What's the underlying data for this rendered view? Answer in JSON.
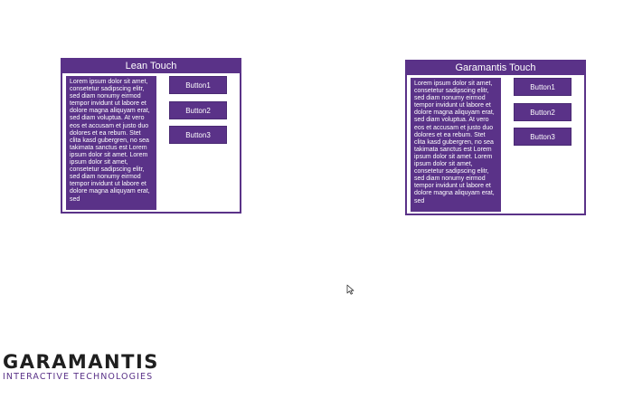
{
  "colors": {
    "accent": "#5a3288",
    "background": "#ffffff",
    "text_on_accent": "#ffffff",
    "logo_dark": "#1f1f1f"
  },
  "panels": [
    {
      "title": "Lean Touch",
      "body_text": "Lorem ipsum dolor sit amet, consetetur sadipscing elitr, sed diam nonumy eirmod tempor invidunt ut labore et dolore magna aliquyam erat, sed diam voluptua. At vero eos et accusam et justo duo dolores et ea rebum. Stet clita kasd gubergren, no sea takimata sanctus est Lorem ipsum dolor sit amet. Lorem ipsum dolor sit amet, consetetur sadipscing elitr, sed diam nonumy eirmod tempor invidunt ut labore et dolore magna aliquyam erat, sed",
      "buttons": [
        "Button1",
        "Button2",
        "Button3"
      ]
    },
    {
      "title": "Garamantis Touch",
      "body_text": "Lorem ipsum dolor sit amet, consetetur sadipscing elitr, sed diam nonumy eirmod tempor invidunt ut labore et dolore magna aliquyam erat, sed diam voluptua. At vero eos et accusam et justo duo dolores et ea rebum. Stet clita kasd gubergren, no sea takimata sanctus est Lorem ipsum dolor sit amet. Lorem ipsum dolor sit amet, consetetur sadipscing elitr, sed diam nonumy eirmod tempor invidunt ut labore et dolore magna aliquyam erat, sed",
      "buttons": [
        "Button1",
        "Button2",
        "Button3"
      ]
    }
  ],
  "logo": {
    "main": "GARAMANTIS",
    "sub": "INTERACTIVE TECHNOLOGIES"
  },
  "icons": {
    "cursor": "mouse-pointer-icon"
  }
}
